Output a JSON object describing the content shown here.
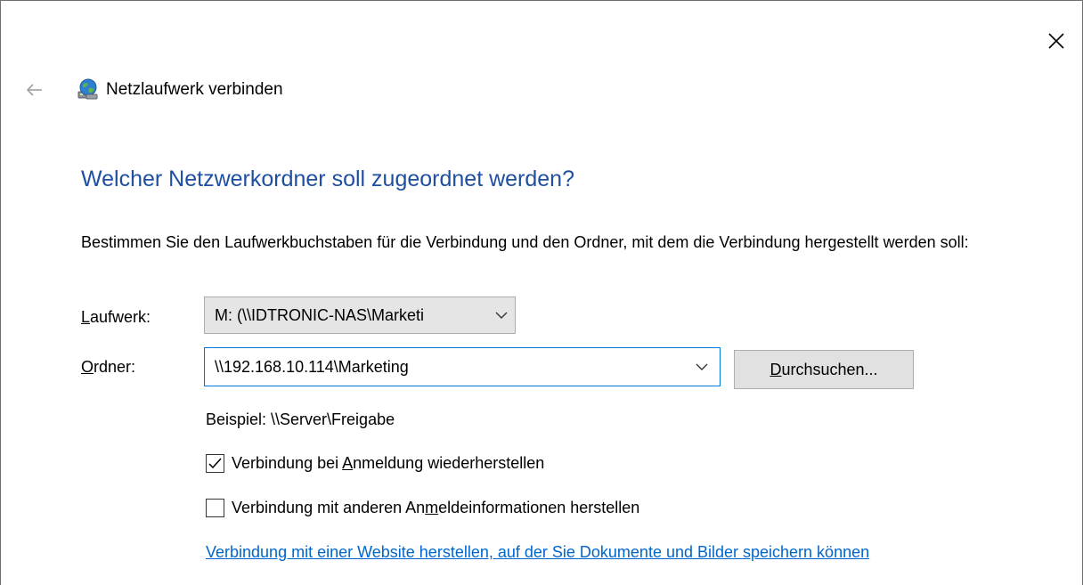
{
  "window": {
    "title": "Netzlaufwerk verbinden",
    "close_icon": "close-icon",
    "back_icon": "back-arrow-icon",
    "title_icon": "network-drive-icon"
  },
  "main": {
    "heading": "Welcher Netzwerkordner soll zugeordnet werden?",
    "description": "Bestimmen Sie den Laufwerkbuchstaben für die Verbindung und den Ordner, mit dem die Verbindung hergestellt werden soll:",
    "drive": {
      "label_prefix": "",
      "label_access": "L",
      "label_rest": "aufwerk:",
      "value": "M: (\\\\IDTRONIC-NAS\\Marketi"
    },
    "folder": {
      "label_access": "O",
      "label_rest": "rdner:",
      "value": "\\\\192.168.10.114\\Marketing"
    },
    "browse_button": {
      "access": "D",
      "rest": "urchsuchen..."
    },
    "example": "Beispiel: \\\\Server\\Freigabe",
    "reconnect": {
      "checked": true,
      "pre": "Verbindung bei ",
      "access": "A",
      "post": "nmeldung wiederherstellen"
    },
    "other_credentials": {
      "checked": false,
      "pre": "Verbindung mit anderen An",
      "access": "m",
      "post": "eldeinformationen herstellen"
    },
    "website_link": "Verbindung mit einer Website herstellen, auf der Sie Dokumente und Bilder speichern können"
  },
  "colors": {
    "heading": "#1e4fa0",
    "link": "#0066cc",
    "focus_border": "#0078d7"
  }
}
